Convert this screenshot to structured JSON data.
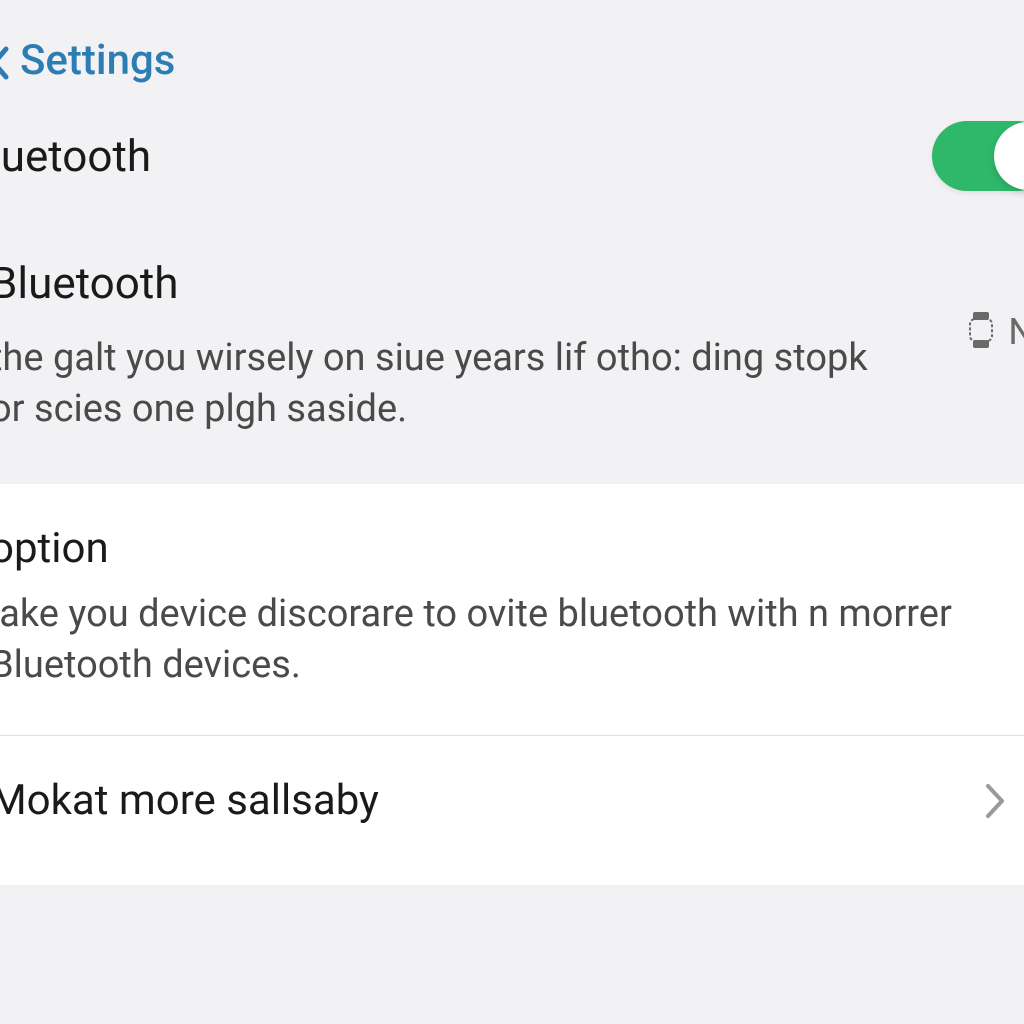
{
  "header": {
    "back_label": "Settings"
  },
  "toggle_section": {
    "label": "luetooth",
    "state": "on"
  },
  "info_section": {
    "title": "Bluetooth",
    "description": "the galt you wirsely on siue years lif otho: ding stopk or scies one plgh saside.",
    "badge": "N"
  },
  "option_section": {
    "title": "option",
    "description": "lake you device discorare to ovite bluetooth with n morrer Bluetooth devices."
  },
  "nav_row": {
    "label": "Mokat more sallsaby"
  },
  "colors": {
    "accent": "#2d7db5",
    "toggle_on": "#2fb86a"
  }
}
